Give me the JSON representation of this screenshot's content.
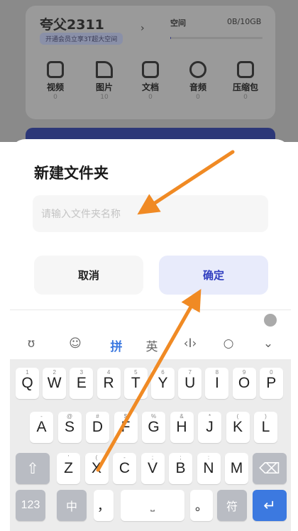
{
  "background_app": {
    "username": "夸父2311",
    "vip_promo": "开通会员立享3T超大空间",
    "space_label": "空间",
    "space_value": "0B/10GB",
    "space_used_fraction": 0.01,
    "categories": [
      {
        "label": "视频",
        "count": "0",
        "icon": "video-icon"
      },
      {
        "label": "图片",
        "count": "10",
        "icon": "image-icon"
      },
      {
        "label": "文档",
        "count": "0",
        "icon": "document-icon"
      },
      {
        "label": "音频",
        "count": "0",
        "icon": "audio-icon"
      },
      {
        "label": "压缩包",
        "count": "0",
        "icon": "archive-icon"
      }
    ]
  },
  "dialog": {
    "title": "新建文件夹",
    "input_placeholder": "请输入文件夹名称",
    "input_value": "",
    "cancel_label": "取消",
    "confirm_label": "确定"
  },
  "keyboard": {
    "toolbar": [
      "emoji-keyboard-icon",
      "smiley-icon",
      "拼",
      "英",
      "cursor-icon",
      "search-icon",
      "collapse-icon"
    ],
    "toolbar_pinyin": "拼",
    "toolbar_english": "英",
    "row1": [
      "Q",
      "W",
      "E",
      "R",
      "T",
      "Y",
      "U",
      "I",
      "O",
      "P"
    ],
    "row1_sup": [
      "1",
      "2",
      "3",
      "4",
      "5",
      "6",
      "7",
      "8",
      "9",
      "0"
    ],
    "row2": [
      "A",
      "S",
      "D",
      "F",
      "G",
      "H",
      "J",
      "K",
      "L"
    ],
    "row2_sup": [
      "-",
      "@",
      "#",
      "$",
      "%",
      "&",
      "*",
      "(",
      ")"
    ],
    "row3": [
      "Z",
      "X",
      "C",
      "V",
      "B",
      "N",
      "M"
    ],
    "row3_sup": [
      "'",
      "(",
      "-",
      ";",
      ";",
      ":",
      ""
    ],
    "bottom_123": "123",
    "bottom_zh": "中",
    "bottom_comma": "，",
    "bottom_period": "。",
    "bottom_symbol": "符"
  },
  "annotation": {
    "arrow_color": "#f08a24"
  }
}
